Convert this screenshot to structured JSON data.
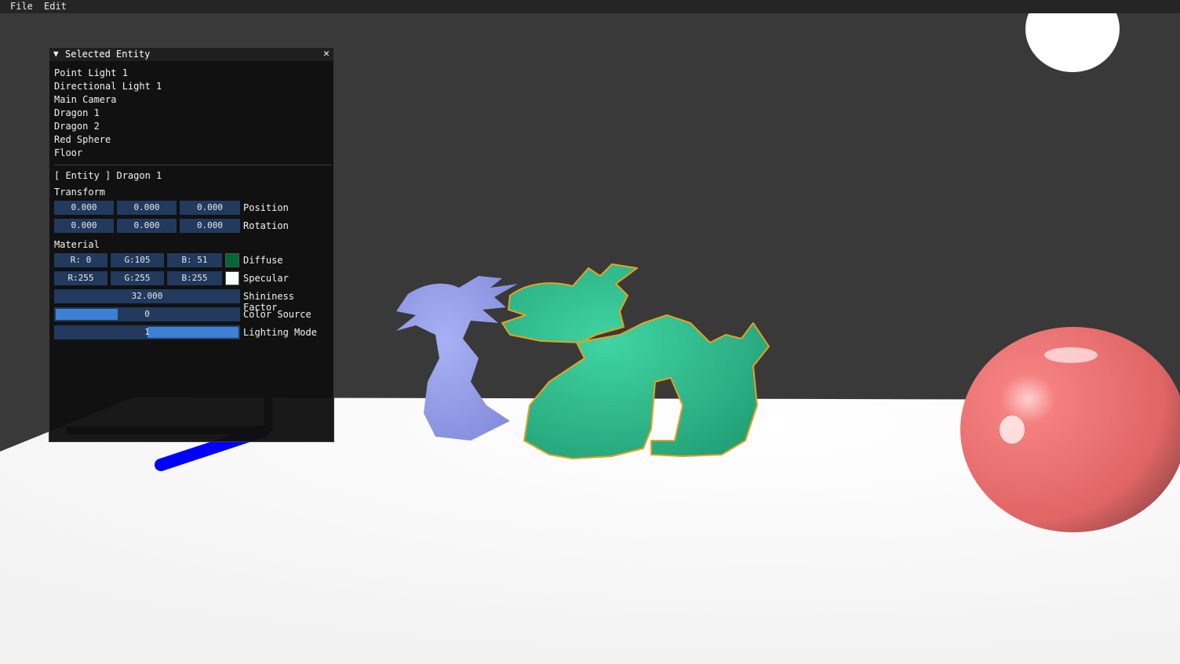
{
  "menu": {
    "file": "File",
    "edit": "Edit"
  },
  "panel": {
    "title": "Selected Entity",
    "collapse_icon": "▼",
    "close_icon": "✕",
    "entities": [
      "Point Light 1",
      "Directional Light 1",
      "Main Camera",
      "Dragon 1",
      "Dragon 2",
      "Red Sphere",
      "Floor"
    ],
    "selected_header": "[ Entity ] Dragon 1",
    "transform": {
      "label": "Transform",
      "position": [
        "0.000",
        "0.000",
        "0.000"
      ],
      "position_label": "Position",
      "rotation": [
        "0.000",
        "0.000",
        "0.000"
      ],
      "rotation_label": "Rotation"
    },
    "material": {
      "label": "Material",
      "diffuse": [
        "R:  0",
        "G:105",
        "B: 51"
      ],
      "diffuse_label": "Diffuse",
      "diffuse_color": "#006933",
      "specular": [
        "R:255",
        "G:255",
        "B:255"
      ],
      "specular_label": "Specular",
      "specular_color": "#ffffff",
      "shininess": "32.000",
      "shininess_label": "Shininess Factor",
      "color_source": "0",
      "color_source_fraction": 0.34,
      "color_source_label": "Color Source",
      "lighting_mode": "1",
      "lighting_mode_fraction": 0.5,
      "lighting_mode_label": "Lighting Mode"
    }
  },
  "colors": {
    "wall": "#393939",
    "floor": "#ffffff",
    "dragon1": "#2fb58a",
    "dragon1_outline": "#e8a020",
    "dragon2": "#8c96e6",
    "sphere": "#f07070",
    "accent": "#3d80d4",
    "field_bg": "#223a5e"
  }
}
